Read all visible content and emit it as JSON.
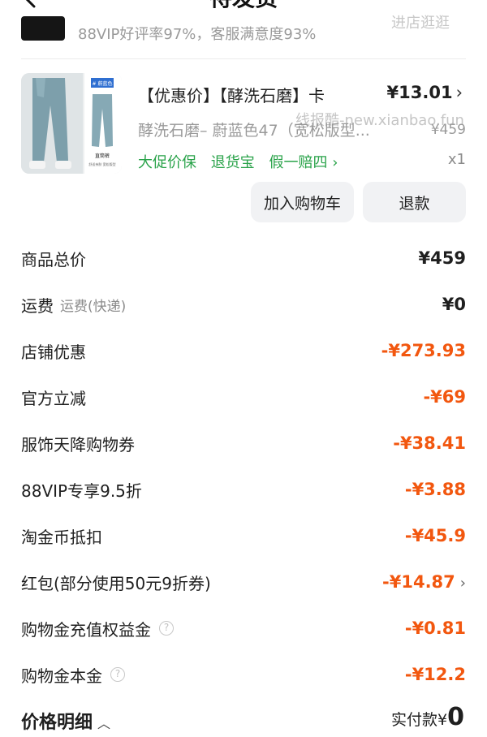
{
  "header": {
    "title": "待发货",
    "back_icon": "chevron-left-icon"
  },
  "store": {
    "rating_text": "88VIP好评率97%，客服满意度93%",
    "link_text": "进店逛逛"
  },
  "product": {
    "title": "【优惠价】【酵洗石磨】卡",
    "price": "¥13.01",
    "sku": "酵洗石磨– 蔚蓝色47（宽松版型...",
    "original_price": "¥459",
    "tags": [
      "大促价保",
      "退货宝",
      "假一赔四 ›"
    ],
    "quantity": "x1",
    "image_labels": {
      "badge": "# 蔚蓝色",
      "caption": "直筒裤",
      "note": "舒适亲肤 宽松版型"
    }
  },
  "watermark": "线报酷-new.xianbao.fun",
  "actions": {
    "add_to_cart": "加入购物车",
    "refund": "退款"
  },
  "summary": [
    {
      "label": "商品总价",
      "value": "¥459",
      "negative": false
    },
    {
      "label": "运费",
      "sub": "运费(快递)",
      "value": "¥0",
      "negative": false
    },
    {
      "label": "店铺优惠",
      "value": "-¥273.93",
      "negative": true
    },
    {
      "label": "官方立减",
      "value": "-¥69",
      "negative": true
    },
    {
      "label": "服饰天降购物券",
      "value": "-¥38.41",
      "negative": true
    },
    {
      "label": "88VIP专享9.5折",
      "value": "-¥3.88",
      "negative": true
    },
    {
      "label": "淘金币抵扣",
      "value": "-¥45.9",
      "negative": true
    },
    {
      "label": "红包(部分使用50元9折券)",
      "value": "-¥14.87",
      "negative": true,
      "has_chevron": true
    },
    {
      "label": "购物金充值权益金",
      "value": "-¥0.81",
      "negative": true,
      "help": true
    },
    {
      "label": "购物金本金",
      "value": "-¥12.2",
      "negative": true,
      "help": true
    }
  ],
  "footer": {
    "toggle_label": "价格明细",
    "paid_label": "实付款¥",
    "paid_amount": "0"
  },
  "colors": {
    "discount": "#f2570f",
    "tag_green": "#2aa34a",
    "button_bg": "#f1f2f4"
  }
}
